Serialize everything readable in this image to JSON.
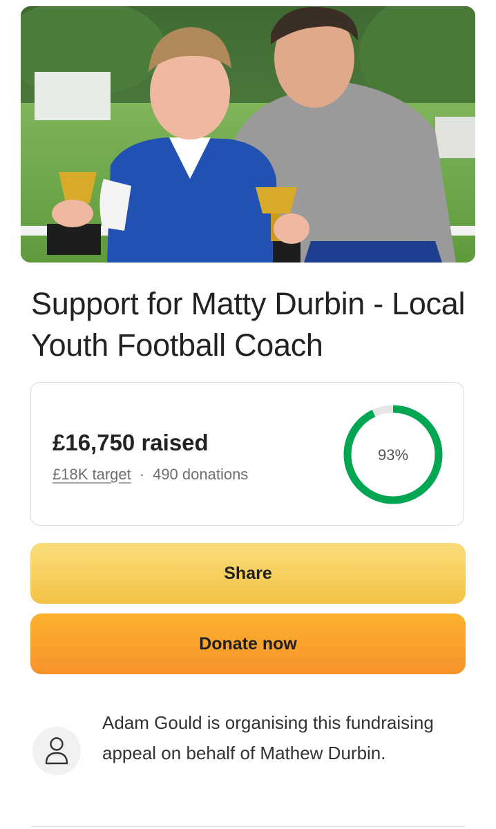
{
  "hero_image": {
    "alt": "Boy in blue football kit holding a trophy next to a man in a grey t-shirt"
  },
  "title": "Support for Matty Durbin - Local Youth Football Coach",
  "progress": {
    "raised_text": "£16,750 raised",
    "target_text": "£18K target",
    "separator": "·",
    "donations_text": "490 donations",
    "percent_text": "93%",
    "percent_value": 93,
    "ring_color": "#00a651",
    "ring_track_color": "#e6e6e6"
  },
  "buttons": {
    "share_label": "Share",
    "donate_label": "Donate now"
  },
  "organiser": {
    "icon": "user-icon",
    "text": "Adam Gould is organising this fundraising appeal on behalf of Mathew Durbin."
  }
}
